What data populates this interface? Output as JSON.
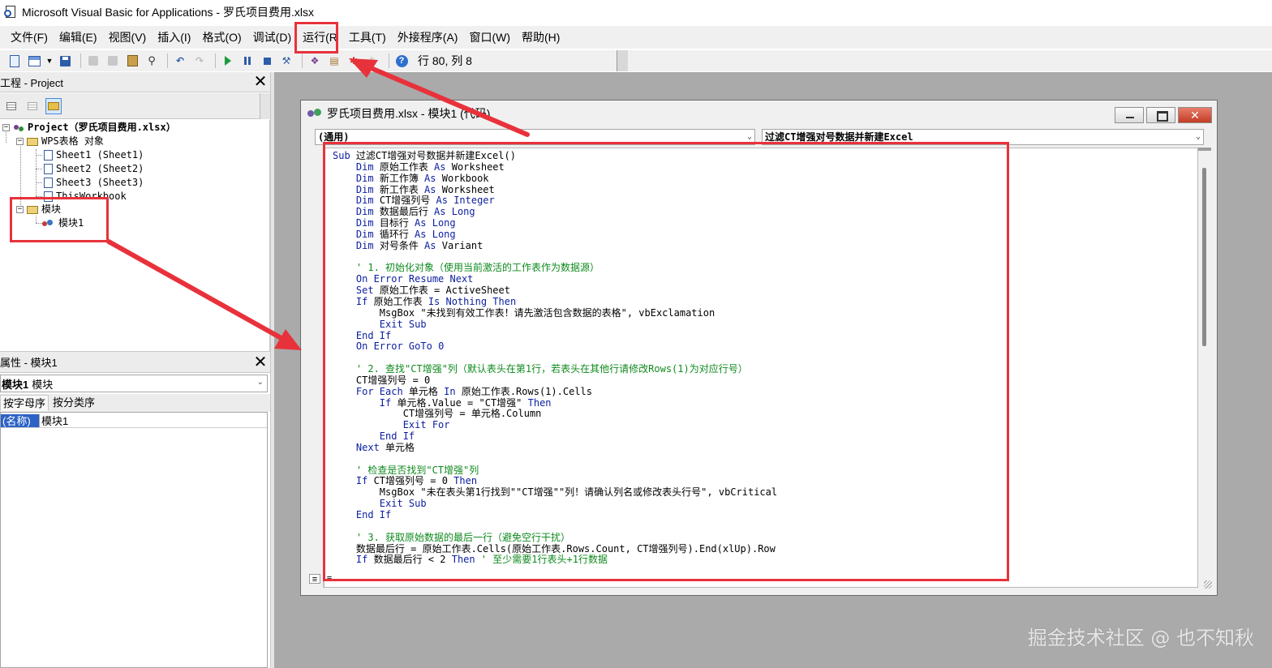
{
  "window": {
    "title": "Microsoft Visual Basic for Applications - 罗氏项目费用.xlsx"
  },
  "menu": [
    "文件(F)",
    "编辑(E)",
    "视图(V)",
    "插入(I)",
    "格式(O)",
    "调试(D)",
    "运行(R",
    "工具(T)",
    "外接程序(A)",
    "窗口(W)",
    "帮助(H)"
  ],
  "toolbar": {
    "position_readout": "行 80, 列 8",
    "help_glyph": "?"
  },
  "project_pane": {
    "title": "工程 - Project",
    "close_glyph": "✕",
    "tree": {
      "project": "Project（罗氏项目费用.xlsx）",
      "objects_folder": "WPS表格 对象",
      "sheet1": "Sheet1 (Sheet1)",
      "sheet2": "Sheet2 (Sheet2)",
      "sheet3": "Sheet3 (Sheet3)",
      "thisworkbook": "ThisWorkbook",
      "modules_folder": "模块",
      "module1": "模块1",
      "expander_minus": "−"
    }
  },
  "properties_pane": {
    "title": "属性 - 模块1",
    "close_glyph": "✕",
    "object_name": "模块1",
    "object_type": "模块",
    "dropdown_glyph": "⌄",
    "tabs": [
      "按字母序",
      "按分类序"
    ],
    "rows": [
      {
        "key": "(名称)",
        "value": "模块1"
      }
    ]
  },
  "code_window": {
    "title": "罗氏项目费用.xlsx - 模块1 (代码)",
    "object_combo": "(通用)",
    "procedure_combo": "过滤CT增强对号数据并新建Excel",
    "dropdown_glyph": "⌄",
    "close_glyph": "✕",
    "view_glyph": "≡",
    "lines": [
      [
        {
          "t": "Sub",
          "c": "kw"
        },
        {
          "t": " 过滤CT增强对号数据并新建Excel()"
        }
      ],
      [
        {
          "t": "    "
        },
        {
          "t": "Dim",
          "c": "kw"
        },
        {
          "t": " 原始工作表 "
        },
        {
          "t": "As",
          "c": "kw"
        },
        {
          "t": " Worksheet"
        }
      ],
      [
        {
          "t": "    "
        },
        {
          "t": "Dim",
          "c": "kw"
        },
        {
          "t": " 新工作簿 "
        },
        {
          "t": "As",
          "c": "kw"
        },
        {
          "t": " Workbook"
        }
      ],
      [
        {
          "t": "    "
        },
        {
          "t": "Dim",
          "c": "kw"
        },
        {
          "t": " 新工作表 "
        },
        {
          "t": "As",
          "c": "kw"
        },
        {
          "t": " Worksheet"
        }
      ],
      [
        {
          "t": "    "
        },
        {
          "t": "Dim",
          "c": "kw"
        },
        {
          "t": " CT增强列号 "
        },
        {
          "t": "As",
          "c": "kw"
        },
        {
          "t": " "
        },
        {
          "t": "Integer",
          "c": "kw"
        }
      ],
      [
        {
          "t": "    "
        },
        {
          "t": "Dim",
          "c": "kw"
        },
        {
          "t": " 数据最后行 "
        },
        {
          "t": "As",
          "c": "kw"
        },
        {
          "t": " "
        },
        {
          "t": "Long",
          "c": "kw"
        }
      ],
      [
        {
          "t": "    "
        },
        {
          "t": "Dim",
          "c": "kw"
        },
        {
          "t": " 目标行 "
        },
        {
          "t": "As",
          "c": "kw"
        },
        {
          "t": " "
        },
        {
          "t": "Long",
          "c": "kw"
        }
      ],
      [
        {
          "t": "    "
        },
        {
          "t": "Dim",
          "c": "kw"
        },
        {
          "t": " 循环行 "
        },
        {
          "t": "As",
          "c": "kw"
        },
        {
          "t": " "
        },
        {
          "t": "Long",
          "c": "kw"
        }
      ],
      [
        {
          "t": "    "
        },
        {
          "t": "Dim",
          "c": "kw"
        },
        {
          "t": " 对号条件 "
        },
        {
          "t": "As",
          "c": "kw"
        },
        {
          "t": " Variant"
        }
      ],
      [
        {
          "t": ""
        }
      ],
      [
        {
          "t": "    "
        },
        {
          "t": "' 1. 初始化对象（使用当前激活的工作表作为数据源）",
          "c": "cm"
        }
      ],
      [
        {
          "t": "    "
        },
        {
          "t": "On Error Resume Next",
          "c": "kw"
        }
      ],
      [
        {
          "t": "    "
        },
        {
          "t": "Set",
          "c": "kw"
        },
        {
          "t": " 原始工作表 = ActiveSheet"
        }
      ],
      [
        {
          "t": "    "
        },
        {
          "t": "If",
          "c": "kw"
        },
        {
          "t": " 原始工作表 "
        },
        {
          "t": "Is Nothing Then",
          "c": "kw"
        }
      ],
      [
        {
          "t": "        MsgBox \"未找到有效工作表！请先激活包含数据的表格\", vbExclamation"
        }
      ],
      [
        {
          "t": "        "
        },
        {
          "t": "Exit Sub",
          "c": "kw"
        }
      ],
      [
        {
          "t": "    "
        },
        {
          "t": "End If",
          "c": "kw"
        }
      ],
      [
        {
          "t": "    "
        },
        {
          "t": "On Error GoTo",
          "c": "kw"
        },
        {
          "t": " "
        },
        {
          "t": "0",
          "c": "kw"
        }
      ],
      [
        {
          "t": ""
        }
      ],
      [
        {
          "t": "    "
        },
        {
          "t": "' 2. 查找\"CT增强\"列（默认表头在第1行，若表头在其他行请修改Rows(1)为对应行号）",
          "c": "cm"
        }
      ],
      [
        {
          "t": "    CT增强列号 = 0"
        }
      ],
      [
        {
          "t": "    "
        },
        {
          "t": "For Each",
          "c": "kw"
        },
        {
          "t": " 单元格 "
        },
        {
          "t": "In",
          "c": "kw"
        },
        {
          "t": " 原始工作表.Rows(1).Cells"
        }
      ],
      [
        {
          "t": "        "
        },
        {
          "t": "If",
          "c": "kw"
        },
        {
          "t": " 单元格.Value = \"CT增强\" "
        },
        {
          "t": "Then",
          "c": "kw"
        }
      ],
      [
        {
          "t": "            CT增强列号 = 单元格.Column"
        }
      ],
      [
        {
          "t": "            "
        },
        {
          "t": "Exit For",
          "c": "kw"
        }
      ],
      [
        {
          "t": "        "
        },
        {
          "t": "End If",
          "c": "kw"
        }
      ],
      [
        {
          "t": "    "
        },
        {
          "t": "Next",
          "c": "kw"
        },
        {
          "t": " 单元格"
        }
      ],
      [
        {
          "t": ""
        }
      ],
      [
        {
          "t": "    "
        },
        {
          "t": "' 检查是否找到\"CT增强\"列",
          "c": "cm"
        }
      ],
      [
        {
          "t": "    "
        },
        {
          "t": "If",
          "c": "kw"
        },
        {
          "t": " CT增强列号 = 0 "
        },
        {
          "t": "Then",
          "c": "kw"
        }
      ],
      [
        {
          "t": "        MsgBox \"未在表头第1行找到\"\"CT增强\"\"列！请确认列名或修改表头行号\", vbCritical"
        }
      ],
      [
        {
          "t": "        "
        },
        {
          "t": "Exit Sub",
          "c": "kw"
        }
      ],
      [
        {
          "t": "    "
        },
        {
          "t": "End If",
          "c": "kw"
        }
      ],
      [
        {
          "t": ""
        }
      ],
      [
        {
          "t": "    "
        },
        {
          "t": "' 3. 获取原始数据的最后一行（避免空行干扰）",
          "c": "cm"
        }
      ],
      [
        {
          "t": "    数据最后行 = 原始工作表.Cells(原始工作表.Rows.Count, CT增强列号).End(xlUp).Row"
        }
      ],
      [
        {
          "t": "    "
        },
        {
          "t": "If",
          "c": "kw"
        },
        {
          "t": " 数据最后行 < 2 "
        },
        {
          "t": "Then",
          "c": "kw"
        },
        {
          "t": " "
        },
        {
          "t": "' 至少需要1行表头+1行数据",
          "c": "cm"
        }
      ]
    ]
  },
  "watermark": "掘金技术社区 @ 也不知秋",
  "colors": {
    "annotation_red": "#e8323b",
    "keyword_blue": "#0b1ea0",
    "comment_green": "#0f8a1e",
    "mdi_background": "#aaaaaa",
    "selection_blue": "#2c62c6"
  }
}
